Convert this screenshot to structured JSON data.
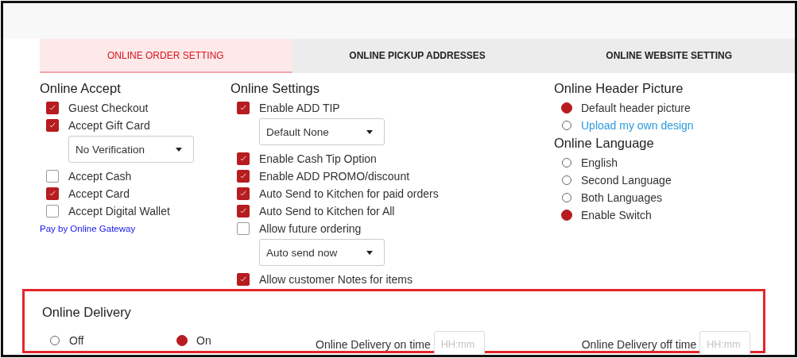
{
  "tabs": [
    {
      "label": "ONLINE ORDER SETTING",
      "selected": true
    },
    {
      "label": "ONLINE PICKUP ADDRESSES",
      "selected": false
    },
    {
      "label": "ONLINE WEBSITE SETTING",
      "selected": false
    }
  ],
  "online_accept": {
    "title": "Online Accept",
    "items": [
      {
        "kind": "checkbox",
        "label": "Guest Checkout",
        "checked": true
      },
      {
        "kind": "checkbox",
        "label": "Accept Gift Card",
        "checked": true
      },
      {
        "kind": "select",
        "value": "No Verification"
      },
      {
        "kind": "checkbox",
        "label": "Accept Cash",
        "checked": false
      },
      {
        "kind": "checkbox",
        "label": "Accept Card",
        "checked": true
      },
      {
        "kind": "checkbox",
        "label": "Accept Digital Wallet",
        "checked": false
      },
      {
        "kind": "link",
        "label": "Pay by Online Gateway"
      }
    ]
  },
  "online_settings": {
    "title": "Online Settings",
    "items": [
      {
        "kind": "checkbox",
        "label": "Enable ADD TIP",
        "checked": true
      },
      {
        "kind": "select",
        "value": "Default None"
      },
      {
        "kind": "checkbox",
        "label": "Enable Cash Tip Option",
        "checked": true
      },
      {
        "kind": "checkbox",
        "label": "Enable ADD PROMO/discount",
        "checked": true
      },
      {
        "kind": "checkbox",
        "label": "Auto Send to Kitchen for paid orders",
        "checked": true
      },
      {
        "kind": "checkbox",
        "label": "Auto Send to Kitchen for All",
        "checked": true
      },
      {
        "kind": "checkbox",
        "label": "Allow future ordering",
        "checked": false
      },
      {
        "kind": "select",
        "value": "Auto send now"
      },
      {
        "kind": "checkbox",
        "label": "Allow customer Notes for items",
        "checked": true
      }
    ]
  },
  "header_picture": {
    "title": "Online Header Picture",
    "options": [
      {
        "kind": "text",
        "label": "Default header picture",
        "selected": true
      },
      {
        "kind": "link",
        "label": "Upload my own design",
        "selected": false
      }
    ]
  },
  "language": {
    "title": "Online Language",
    "options": [
      {
        "label": "English",
        "selected": false
      },
      {
        "label": "Second Language",
        "selected": false
      },
      {
        "label": "Both Languages",
        "selected": false
      },
      {
        "label": "Enable Switch",
        "selected": true
      }
    ]
  },
  "delivery": {
    "title": "Online Delivery",
    "options": [
      {
        "label": "Off",
        "selected": false
      },
      {
        "label": "On",
        "selected": true
      }
    ],
    "on_time": {
      "label": "Online Delivery on time",
      "placeholder": "HH:mm"
    },
    "off_time": {
      "label": "Online Delivery off time",
      "placeholder": "HH:mm"
    }
  }
}
